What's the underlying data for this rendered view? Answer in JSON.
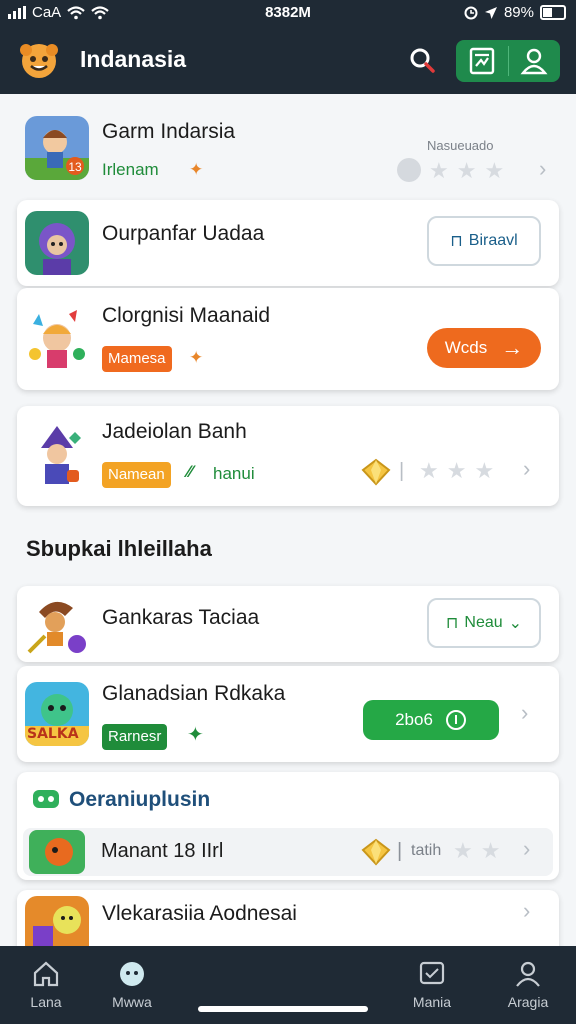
{
  "status": {
    "carrier": "CaA",
    "time": "8382M",
    "battery": "89%"
  },
  "header": {
    "title": "Indanasia"
  },
  "cards": [
    {
      "title": "Garm Indarsia",
      "subtitle": "Irlenam",
      "right_label": "Nasueuado"
    },
    {
      "title": "Ourpanfar Uadaa",
      "button": "Biraavl"
    },
    {
      "title": "Clorgnisi Maanaid",
      "tag": "Mamesa",
      "button": "Wcds"
    },
    {
      "title": "Jadeiolan Banh",
      "tag": "Namean",
      "extra": "hanui"
    }
  ],
  "section": {
    "title": "Sbupkai lhleillaha"
  },
  "cards2": [
    {
      "title": "Gankaras Taciaa",
      "button": "Neau"
    },
    {
      "title": "Glanadsian Rdkaka",
      "tag": "Rarnesr",
      "button": "2bo6",
      "thumb_text": "SALKA"
    }
  ],
  "group": {
    "title": "Oeraniuplusin",
    "rows": [
      {
        "title": "Manant 18 IIrl",
        "extra": "tatih"
      },
      {
        "title": "Vlekarasiia Aodnesai"
      }
    ]
  },
  "nav": [
    {
      "label": "Lana"
    },
    {
      "label": "Mwwa"
    },
    {
      "label": "Mania"
    },
    {
      "label": "Aragia"
    }
  ]
}
